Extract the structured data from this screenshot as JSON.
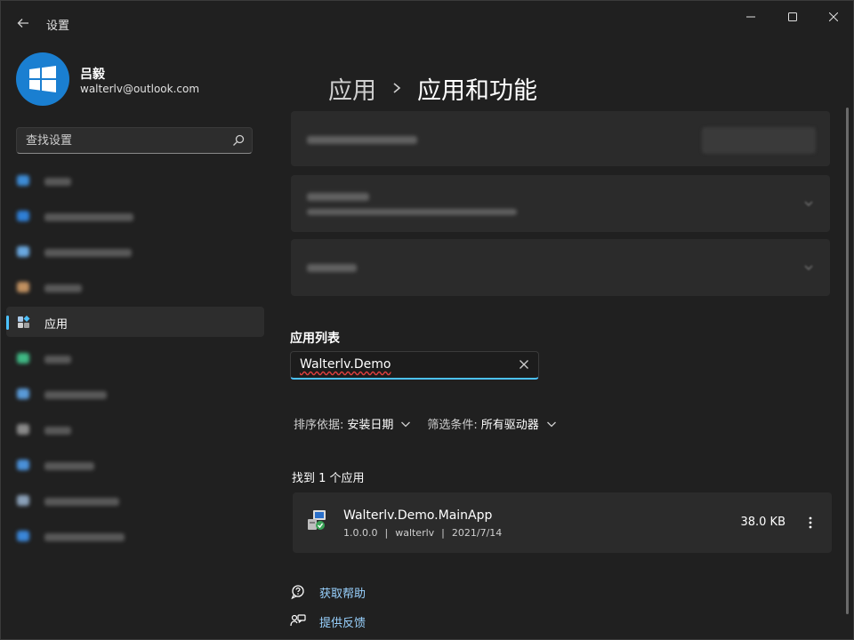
{
  "window": {
    "title": "设置",
    "controls": [
      "minimize-icon",
      "maximize-icon",
      "close-icon"
    ]
  },
  "profile": {
    "name": "吕毅",
    "email": "walterlv@outlook.com",
    "avatar_color": "#1a7fd1"
  },
  "search": {
    "placeholder": "查找设置"
  },
  "sidebar": {
    "selected_label": "应用",
    "accent": "#4cc2ff"
  },
  "breadcrumb": {
    "parent": "应用",
    "current": "应用和功能"
  },
  "app_list": {
    "section_title": "应用列表",
    "search_value": "Walterlv.Demo",
    "sort_label": "排序依据:",
    "sort_value": "安装日期",
    "filter_label": "筛选条件:",
    "filter_value": "所有驱动器",
    "found_text": "找到 1 个应用",
    "apps": [
      {
        "name": "Walterlv.Demo.MainApp",
        "version": "1.0.0.0",
        "publisher": "walterlv",
        "date": "2021/7/14",
        "size": "38.0 KB"
      }
    ]
  },
  "links": {
    "help": "获取帮助",
    "feedback": "提供反馈"
  },
  "colors": {
    "background": "#202020",
    "card": "#2b2b2b",
    "link": "#99d2ff"
  }
}
